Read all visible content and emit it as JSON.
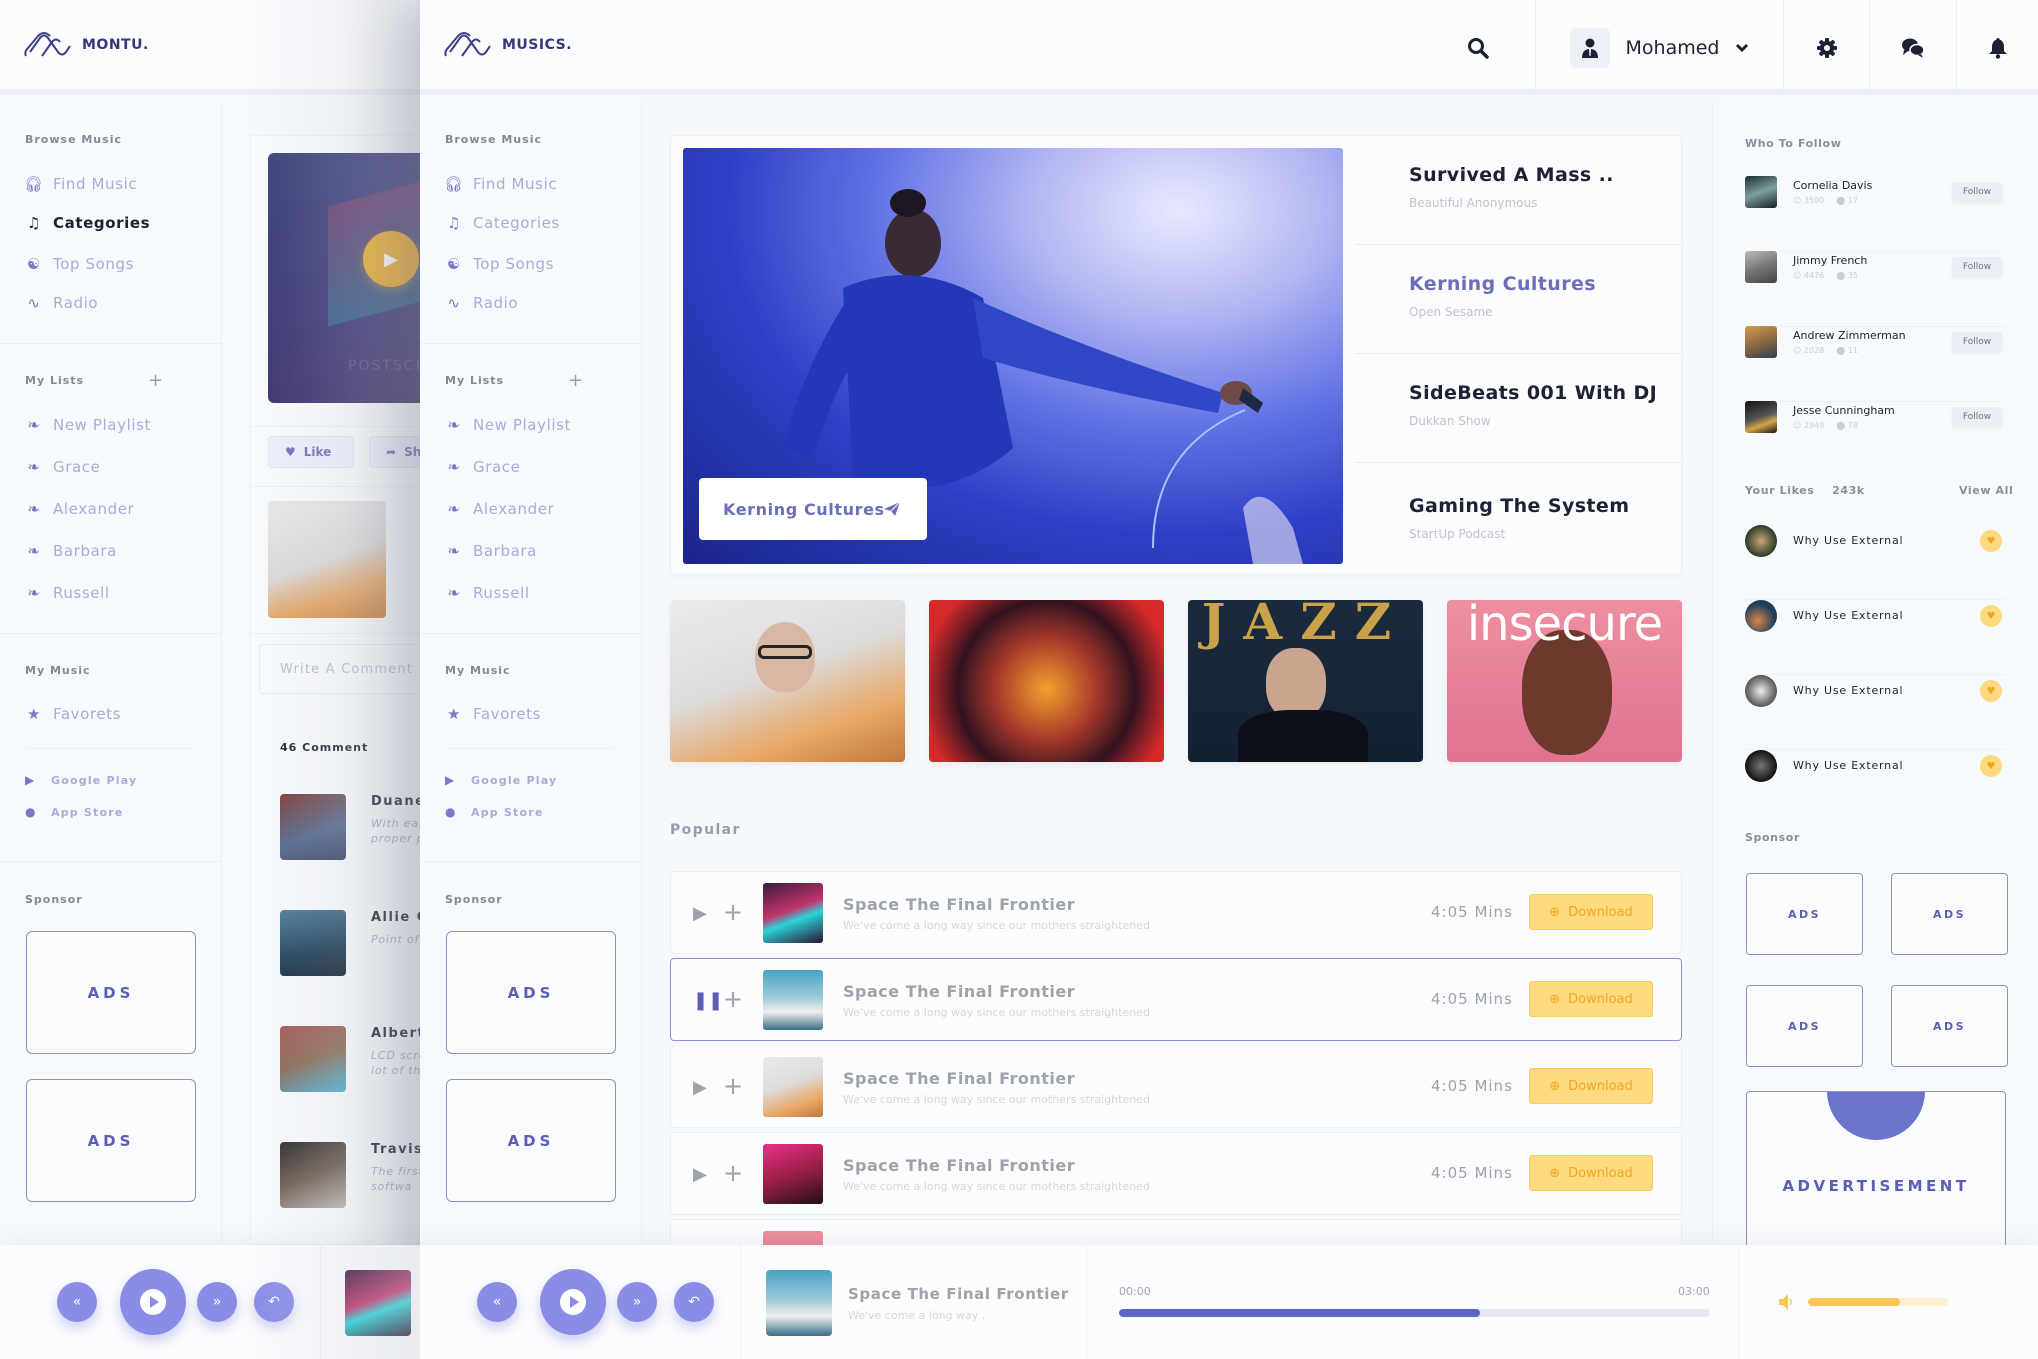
{
  "back_app": {
    "brand": "MONTU.",
    "sidebar": {
      "browse_title": "Browse Music",
      "browse_items": [
        {
          "label": "Find Music",
          "icon": "headphones-icon"
        },
        {
          "label": "Categories",
          "icon": "music-note-icon",
          "active": true
        },
        {
          "label": "Top Songs",
          "icon": "yin-yang-icon"
        },
        {
          "label": "Radio",
          "icon": "pulse-icon"
        }
      ],
      "lists_title": "My Lists",
      "lists": [
        "New Playlist",
        "Grace",
        "Alexander",
        "Barbara",
        "Russell"
      ],
      "music_title": "My Music",
      "music_items": [
        "Favorets"
      ],
      "stores": [
        "Google Play",
        "App Store"
      ],
      "sponsor_title": "Sponsor",
      "ads": [
        "ADS",
        "ADS"
      ]
    },
    "post": {
      "cover_caption": "POSTSCRIPT",
      "like_label": "Like",
      "share_label": "Sh",
      "comment_placeholder": "Write A Comment",
      "comment_count": "46 Comment",
      "comments": [
        {
          "name": "Duane",
          "text": "With eas sharing v proper p"
        },
        {
          "name": "Allie G",
          "text": "Point of S bar-code"
        },
        {
          "name": "Albert",
          "text": "LCD scre nology th a lot of th"
        },
        {
          "name": "Travis",
          "text": "The first advanced al softwa"
        }
      ]
    }
  },
  "app": {
    "brand": "MUSICS.",
    "header": {
      "user_name": "Mohamed"
    },
    "sidebar": {
      "browse_title": "Browse Music",
      "browse_items": [
        {
          "label": "Find Music",
          "icon": "headphones-icon"
        },
        {
          "label": "Categories",
          "icon": "music-note-icon"
        },
        {
          "label": "Top Songs",
          "icon": "yin-yang-icon"
        },
        {
          "label": "Radio",
          "icon": "pulse-icon"
        }
      ],
      "lists_title": "My Lists",
      "lists": [
        "New Playlist",
        "Grace",
        "Alexander",
        "Barbara",
        "Russell"
      ],
      "music_title": "My Music",
      "music_items": [
        "Favorets"
      ],
      "stores": [
        "Google Play",
        "App Store"
      ],
      "sponsor_title": "Sponsor",
      "ads": [
        "ADS",
        "ADS"
      ]
    },
    "hero": {
      "tag_label": "Kerning Cultures",
      "podcasts": [
        {
          "title": "Survived A Mass ..",
          "subtitle": "Beautiful Anonymous"
        },
        {
          "title": "Kerning Cultures",
          "subtitle": "Open Sesame",
          "active": true
        },
        {
          "title": "SideBeats 001 With DJ",
          "subtitle": "Dukkan Show"
        },
        {
          "title": "Gaming The System",
          "subtitle": "StartUp Podcast"
        }
      ]
    },
    "albums": [
      {
        "name": "portrait-album"
      },
      {
        "name": "afro-album"
      },
      {
        "name": "jazz-album",
        "cover_text": "JAZZ"
      },
      {
        "name": "insecure-album",
        "cover_text": "insecure"
      }
    ],
    "popular": {
      "title": "Popular",
      "tracks": [
        {
          "title": "Space The Final Frontier",
          "subtitle": "We've come a long way since our mothers straightened",
          "duration": "4:05  Mins",
          "download": "Download",
          "state": "play"
        },
        {
          "title": "Space The Final Frontier",
          "subtitle": "We've come a long way since our mothers straightened",
          "duration": "4:05  Mins",
          "download": "Download",
          "state": "pause"
        },
        {
          "title": "Space The Final Frontier",
          "subtitle": "We've come a long way since our mothers straightened",
          "duration": "4:05  Mins",
          "download": "Download",
          "state": "play"
        },
        {
          "title": "Space The Final Frontier",
          "subtitle": "We've come a long way since our mothers straightened",
          "duration": "4:05  Mins",
          "download": "Download",
          "state": "play"
        }
      ]
    },
    "right": {
      "follow_title": "Who To Follow",
      "follow": [
        {
          "name": "Cornelia Davis",
          "followers": "3590",
          "tracks": "17",
          "button": "Follow"
        },
        {
          "name": "Jimmy French",
          "followers": "4476",
          "tracks": "35",
          "button": "Follow"
        },
        {
          "name": "Andrew Zimmerman",
          "followers": "2028",
          "tracks": "11",
          "button": "Follow"
        },
        {
          "name": "Jesse Cunningham",
          "followers": "2949",
          "tracks": "78",
          "button": "Follow"
        }
      ],
      "likes_title": "Your Likes",
      "likes_count": "243k",
      "view_all": "View All",
      "likes": [
        "Why Use External",
        "Why Use External",
        "Why Use External",
        "Why Use External"
      ],
      "sponsor_title": "Sponsor",
      "ads": [
        "ADS",
        "ADS",
        "ADS",
        "ADS"
      ],
      "advertisement": "ADVERTISEMENT"
    },
    "player": {
      "track_title": "Space The Final Frontier",
      "track_subtitle": "We've come a long way .",
      "time_start": "00:00",
      "time_end": "03:00",
      "progress_fraction": 0.61,
      "volume_fraction": 0.66
    }
  }
}
